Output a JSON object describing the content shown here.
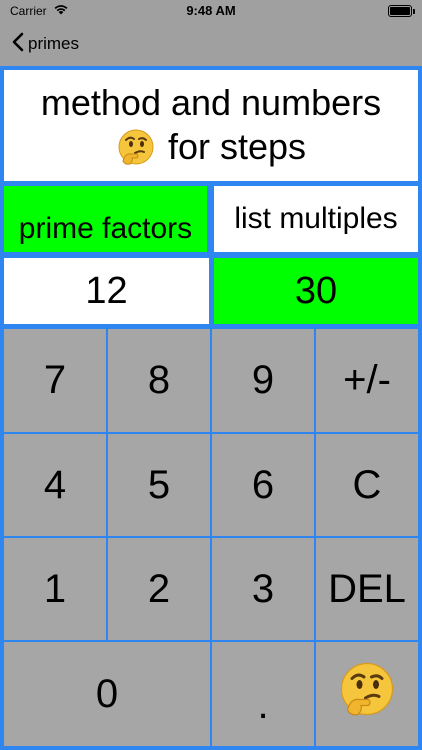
{
  "status": {
    "carrier": "Carrier",
    "time": "9:48 AM"
  },
  "nav": {
    "back_label": "primes"
  },
  "title": {
    "line1": "method and numbers",
    "line2": "for steps"
  },
  "methods": {
    "left": "prime factors",
    "right": "list multiples"
  },
  "numbers": {
    "left": "12",
    "right": "30"
  },
  "keys": {
    "k7": "7",
    "k8": "8",
    "k9": "9",
    "pm": "+/-",
    "k4": "4",
    "k5": "5",
    "k6": "6",
    "clear": "C",
    "k1": "1",
    "k2": "2",
    "k3": "3",
    "del": "DEL",
    "k0": "0",
    "dot": "."
  },
  "colors": {
    "accent_green": "#00ff00",
    "border_blue": "#2f86f0",
    "key_gray": "#a6a6a6",
    "bar_gray": "#a0a0a0"
  },
  "icons": {
    "thinking": "thinking-face-emoji-icon"
  }
}
